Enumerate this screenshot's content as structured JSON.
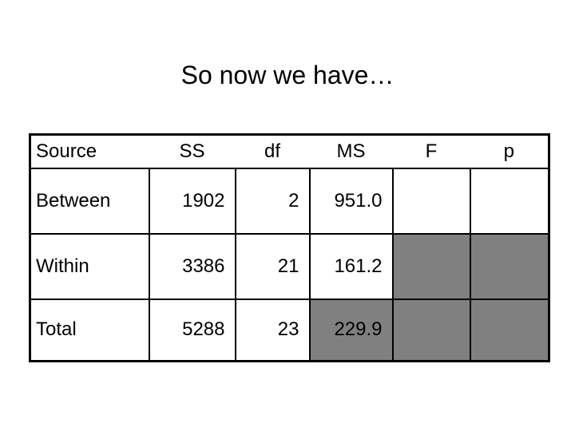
{
  "slide": {
    "title": "So now we have…"
  },
  "table": {
    "headers": {
      "source": "Source",
      "ss": "SS",
      "df": "df",
      "ms": "MS",
      "f": "F",
      "p": "p"
    },
    "rows": [
      {
        "source": "Between",
        "ss": "1902",
        "df": "2",
        "ms": "951.0",
        "f": "",
        "p": "",
        "shaded": []
      },
      {
        "source": "Within",
        "ss": "3386",
        "df": "21",
        "ms": "161.2",
        "f": "",
        "p": "",
        "shaded": [
          "f",
          "p"
        ]
      },
      {
        "source": "Total",
        "ss": "5288",
        "df": "23",
        "ms": "229.9",
        "f": "",
        "p": "",
        "shaded": [
          "ms",
          "f",
          "p"
        ]
      }
    ],
    "shade_color": "#808080"
  }
}
